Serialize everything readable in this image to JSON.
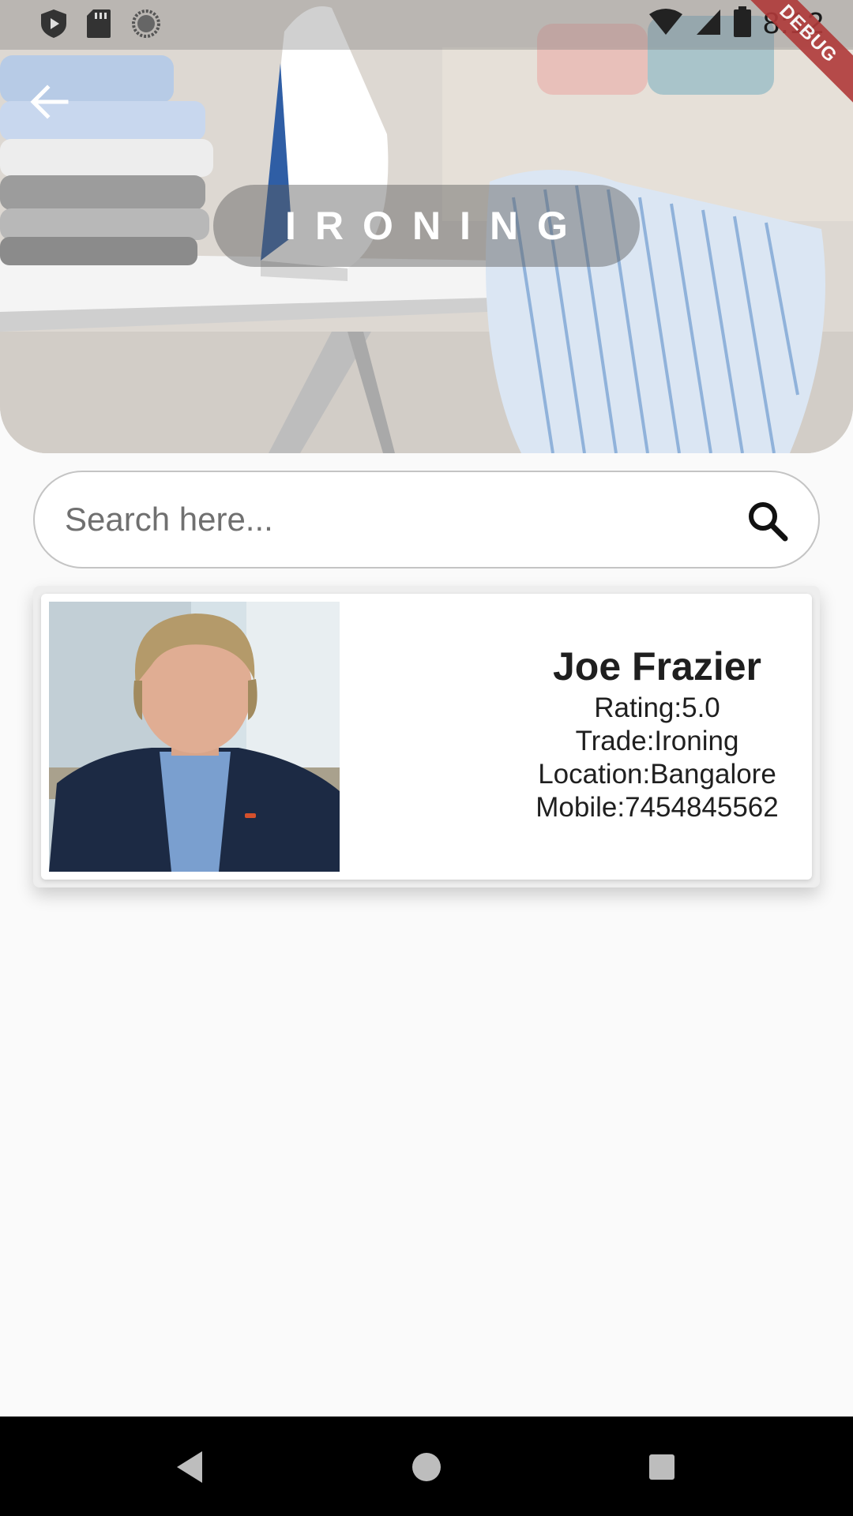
{
  "status_bar": {
    "time": "8:12",
    "debug_label": "DEBUG",
    "left_icons": [
      "shield-play-icon",
      "sd-card-icon",
      "sync-circle-icon"
    ],
    "right_icons": [
      "wifi-icon",
      "signal-icon",
      "battery-icon"
    ]
  },
  "header": {
    "title": "IRONING",
    "back_icon": "arrow-back-icon"
  },
  "search": {
    "placeholder": "Search here...",
    "value": "",
    "icon": "search-icon"
  },
  "results": [
    {
      "name": "Joe Frazier",
      "rating": "Rating:5.0",
      "trade": "Trade:Ironing",
      "location": "Location:Bangalore",
      "mobile": "Mobile:7454845562"
    }
  ],
  "nav_bar": {
    "icons": [
      "back-triangle-icon",
      "home-circle-icon",
      "recents-square-icon"
    ]
  },
  "colors": {
    "background": "#fafafa",
    "debug_ribbon": "#b03a3a",
    "nav_bar": "#000000"
  }
}
